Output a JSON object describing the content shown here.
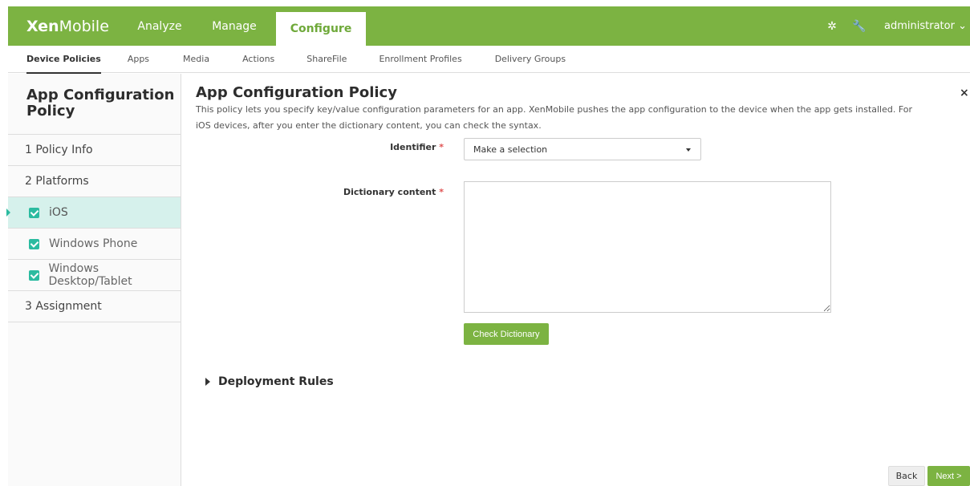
{
  "header": {
    "logo_bold": "Xen",
    "logo_rest": "Mobile",
    "tabs": [
      "Analyze",
      "Manage",
      "Configure"
    ],
    "active_tab": "Configure",
    "user": "administrator",
    "colors": {
      "brand": "#7cb342",
      "accent": "#2bbba0"
    }
  },
  "subnav": {
    "items": [
      "Device Policies",
      "Apps",
      "Media",
      "Actions",
      "ShareFile",
      "Enrollment Profiles",
      "Delivery Groups"
    ],
    "active": "Device Policies"
  },
  "sidebar": {
    "title": "App Configuration Policy",
    "steps": {
      "policy_info": "1  Policy Info",
      "platforms": "2  Platforms",
      "assignment": "3  Assignment"
    },
    "platforms": [
      "iOS",
      "Windows Phone",
      "Windows Desktop/Tablet"
    ],
    "active_platform": "iOS"
  },
  "main": {
    "title": "App Configuration Policy",
    "description": "This policy lets you specify key/value configuration parameters for an app. XenMobile pushes the app configuration to the device when the app gets installed. For iOS devices, after you enter the dictionary content, you can check the syntax.",
    "identifier_label": "Identifier",
    "identifier_value": "Make a selection",
    "dictionary_label": "Dictionary content",
    "required_mark": "*",
    "check_button": "Check Dictionary",
    "deployment_rules": "Deployment Rules",
    "close_glyph": "×"
  },
  "footer": {
    "back": "Back",
    "next": "Next >"
  }
}
